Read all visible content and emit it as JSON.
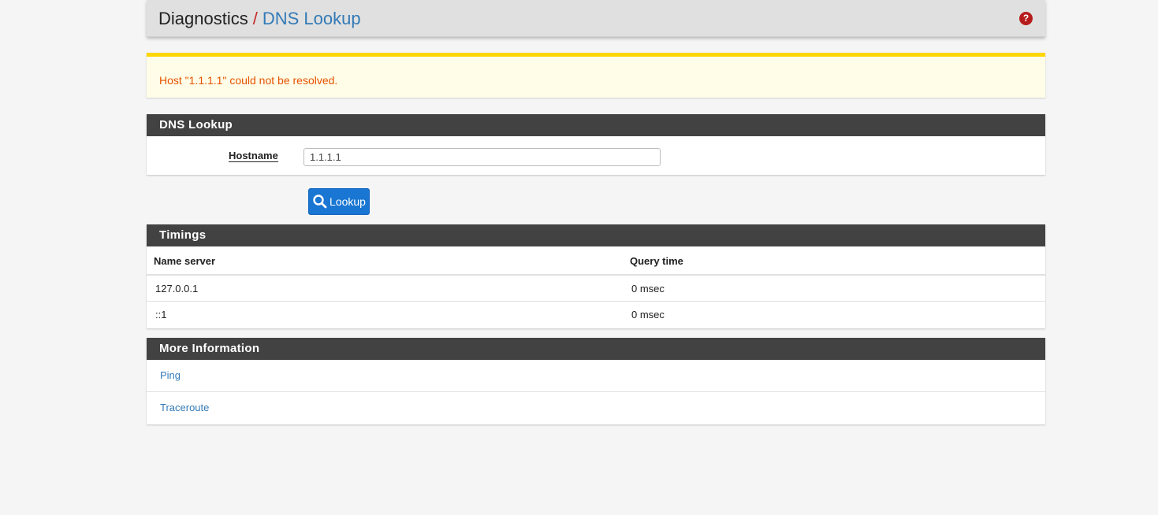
{
  "breadcrumb": {
    "section": "Diagnostics",
    "separator": "/",
    "page": "DNS Lookup"
  },
  "help_icon": {
    "glyph": "?",
    "color": "#b71c1c"
  },
  "alert": {
    "message": "Host \"1.1.1.1\" could not be resolved.",
    "text_color": "#e65100",
    "border_color": "#ffd600"
  },
  "dns_panel": {
    "title": "DNS Lookup",
    "hostname_label": "Hostname",
    "hostname_value": "1.1.1.1",
    "lookup_button_label": "Lookup",
    "lookup_icon": "search-icon",
    "button_color": "#1976d2"
  },
  "timings": {
    "title": "Timings",
    "columns": [
      "Name server",
      "Query time"
    ],
    "rows": [
      {
        "server": "127.0.0.1",
        "time": "0 msec"
      },
      {
        "server": "::1",
        "time": "0 msec"
      }
    ]
  },
  "more_info": {
    "title": "More Information",
    "links": [
      "Ping",
      "Traceroute"
    ]
  }
}
